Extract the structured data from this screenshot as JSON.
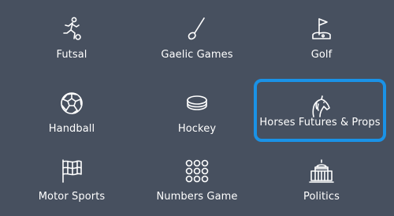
{
  "sports": [
    {
      "label": "Futsal",
      "icon": "futsal-player-icon"
    },
    {
      "label": "Gaelic Games",
      "icon": "gaelic-stick-icon"
    },
    {
      "label": "Golf",
      "icon": "golf-flag-icon"
    },
    {
      "label": "Handball",
      "icon": "handball-icon"
    },
    {
      "label": "Hockey",
      "icon": "hockey-puck-icon"
    },
    {
      "label": "Horses Futures & Props",
      "icon": "horse-head-icon",
      "selected": true
    },
    {
      "label": "Motor Sports",
      "icon": "checkered-flag-icon"
    },
    {
      "label": "Numbers Game",
      "icon": "numbers-grid-icon"
    },
    {
      "label": "Politics",
      "icon": "capitol-building-icon"
    }
  ],
  "colors": {
    "background": "#47505f",
    "text": "#ffffff",
    "selection_border": "#1a92e6"
  }
}
